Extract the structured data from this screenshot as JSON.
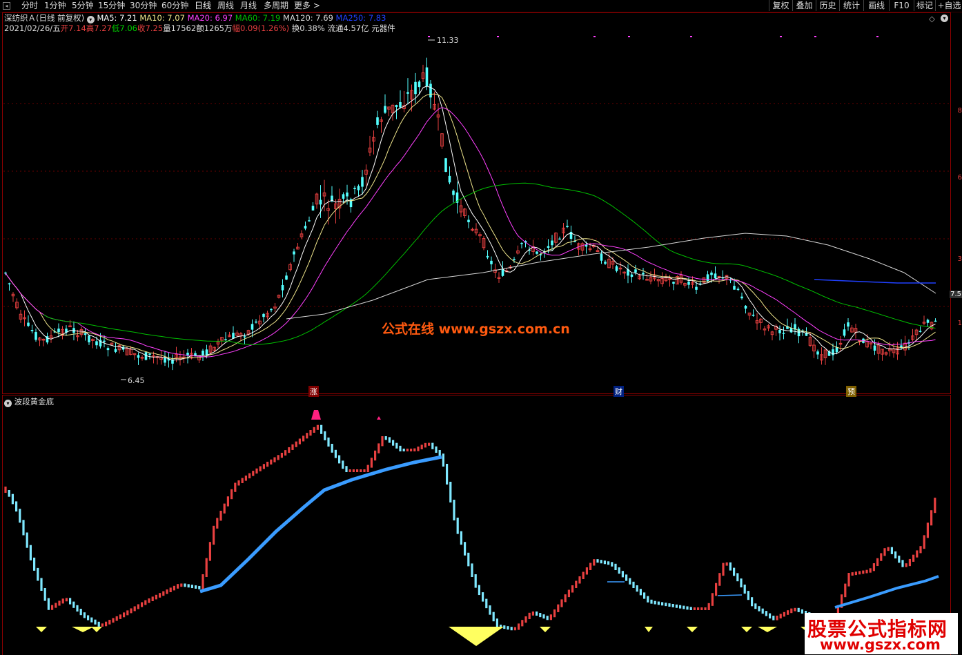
{
  "toolbar": {
    "tabs": [
      "分时",
      "1分钟",
      "5分钟",
      "15分钟",
      "30分钟",
      "60分钟",
      "日线",
      "周线",
      "月线",
      "多周期",
      "更多 >"
    ],
    "active_tab": "日线",
    "right_buttons": [
      "复权",
      "叠加",
      "历史",
      "统计",
      "画线",
      "F10",
      "标记",
      "+自选"
    ]
  },
  "info": {
    "stock": "深纺织Ａ",
    "mode": "(日线 前复权)",
    "ma5": "MA5: 7.21",
    "ma10": "MA10: 7.07",
    "ma20": "MA20: 6.97",
    "ma60": "MA60: 7.19",
    "ma120": "MA120: 7.69",
    "ma250": "MA250: 7.83",
    "date": "2021/02/26/五",
    "open": "开7.14",
    "high": "高7.27",
    "low": "低7.06",
    "close": "收7.25",
    "volume": "量17562",
    "amount": "额1265万",
    "change": "幅0.09(1.26%)",
    "turnover": "换0.38%",
    "float": "流通4.57亿",
    "sector": "元器件"
  },
  "colors": {
    "up": "#e84040",
    "down": "#54ffff",
    "ma5": "#ffffff",
    "ma10": "#f0e68c",
    "ma20": "#ff40ff",
    "ma60": "#00c000",
    "ma120": "#d8d8d8",
    "ma250": "#2040ff",
    "blueline": "#3a9cff",
    "yellow": "#ffff60",
    "pink": "#ff2080"
  },
  "price_axis": [
    "8",
    "6",
    "3",
    "1"
  ],
  "price_marker": "7.5",
  "annotations": {
    "high": "11.33",
    "low": "6.45"
  },
  "signals": [
    "涨",
    "财",
    "预"
  ],
  "indicator": {
    "name": "波段黄金底"
  },
  "watermark": "公式在线  www.gszx.com.cn",
  "logo": {
    "line1": "股票公式指标网",
    "line2": "www.gszx.com"
  },
  "chart_data": {
    "type": "candlestick",
    "series_note": "daily candles with moving averages and oscillator",
    "high": 11.33,
    "low": 6.45,
    "ma_values": {
      "MA5": 7.21,
      "MA10": 7.07,
      "MA20": 6.97,
      "MA60": 7.19,
      "MA120": 7.69,
      "MA250": 7.83
    }
  }
}
